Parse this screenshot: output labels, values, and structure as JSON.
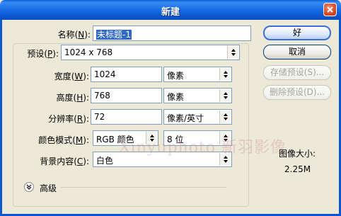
{
  "window": {
    "title": "新建"
  },
  "name": {
    "label": "名称(",
    "key": "N",
    "tail": "):",
    "value": "未标题-1"
  },
  "preset": {
    "label": "预设(",
    "key": "P",
    "tail": "):",
    "value": "1024 x 768"
  },
  "width": {
    "label": "宽度(",
    "key": "W",
    "tail": "):",
    "value": "1024",
    "unit": "像素"
  },
  "height": {
    "label": "高度(",
    "key": "H",
    "tail": "):",
    "value": "768",
    "unit": "像素"
  },
  "resolution": {
    "label": "分辨率(",
    "key": "R",
    "tail": "):",
    "value": "72",
    "unit": "像素/英寸"
  },
  "color_mode": {
    "label": "颜色模式(",
    "key": "M",
    "tail": "):",
    "value": "RGB 颜色",
    "depth": "8 位"
  },
  "background": {
    "label": "背景内容(",
    "key": "C",
    "tail": "):",
    "value": "白色"
  },
  "advanced": {
    "label": "高级"
  },
  "buttons": {
    "ok": "好",
    "cancel": "取消",
    "save_preset": "存储预设(S)...",
    "delete_preset": "删除预设(D)..."
  },
  "image_size": {
    "label": "图像大小:",
    "value": "2.25M"
  },
  "watermark": "Xinyuphoto 新羽影像"
}
